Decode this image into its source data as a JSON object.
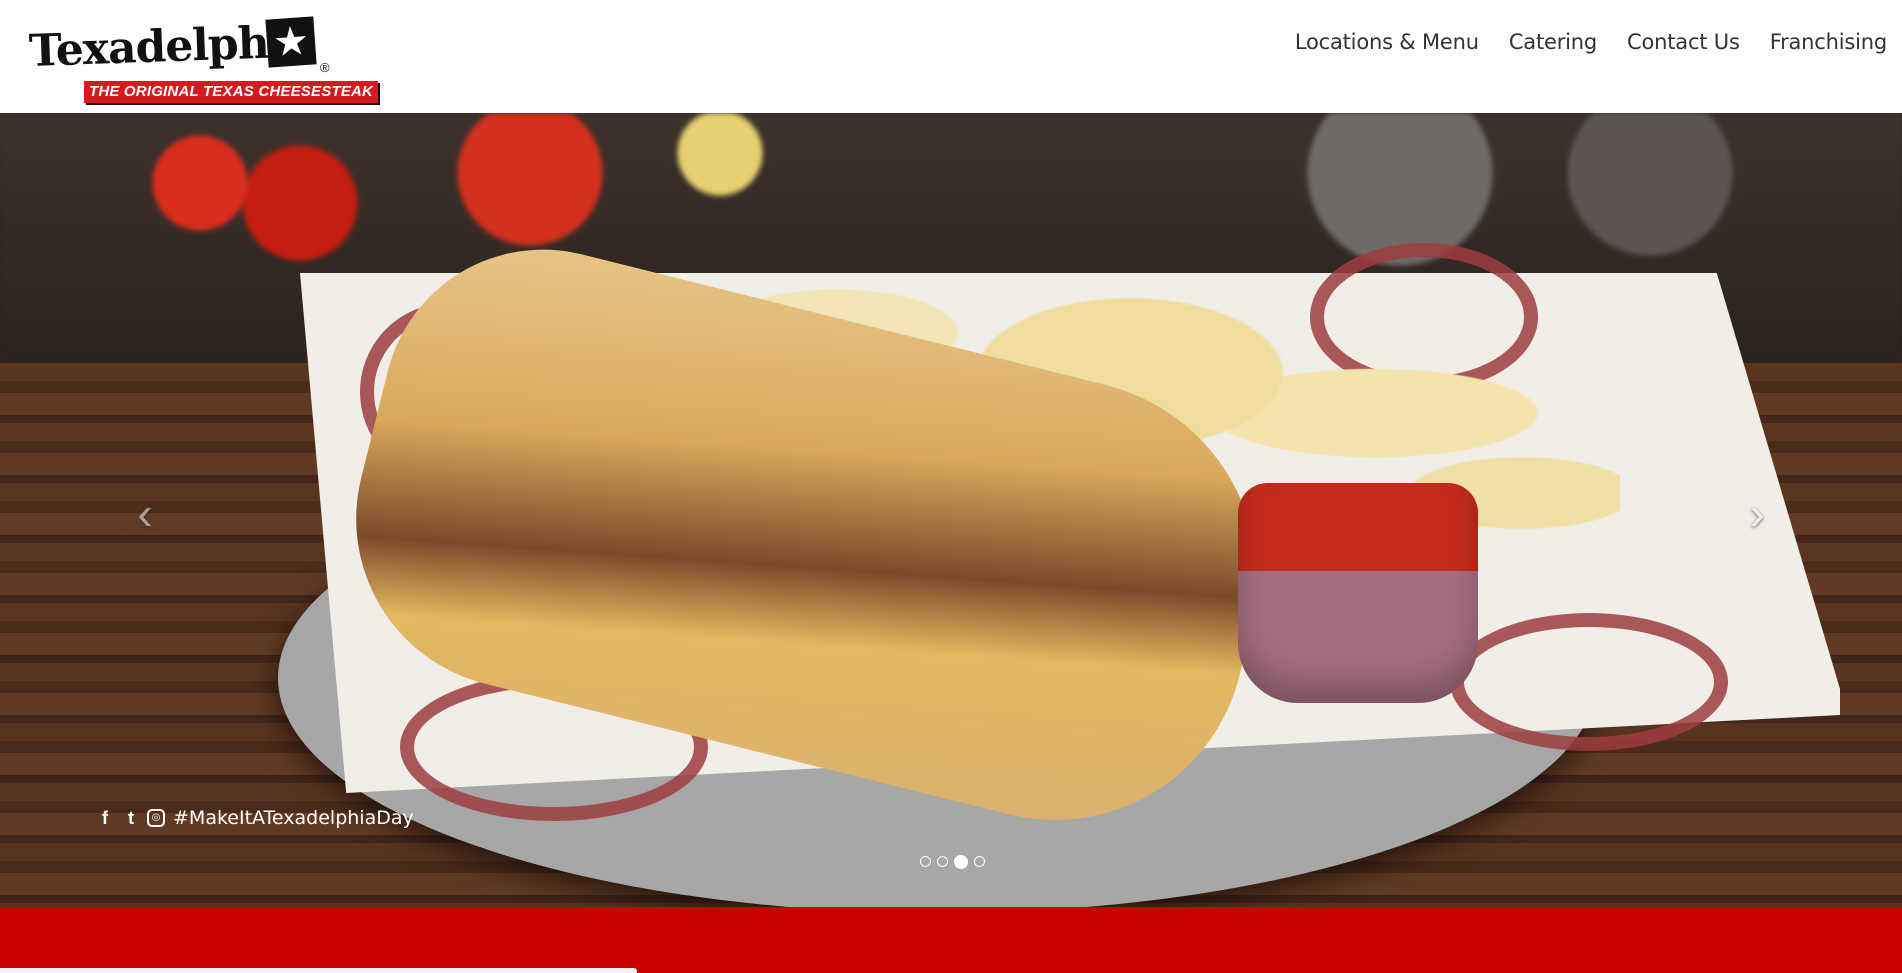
{
  "header": {
    "logo": {
      "wordmark": "Texadelphia",
      "star": "★",
      "registered": "®",
      "tagline": "THE ORIGINAL TEXAS CHEESESTEAK"
    },
    "nav": [
      {
        "label": "Locations & Menu"
      },
      {
        "label": "Catering"
      },
      {
        "label": "Contact Us"
      },
      {
        "label": "Franchising"
      }
    ]
  },
  "hero": {
    "image": "cheesesteak-with-chips-and-salsa",
    "prev_arrow": "‹",
    "next_arrow": "›",
    "social": {
      "facebook": "f",
      "twitter": "t",
      "instagram": "◎",
      "hashtag": "#MakeItATexadelphiaDay"
    },
    "slides_total": 4,
    "active_slide": 3
  },
  "colors": {
    "brand_red": "#cc0000",
    "logo_red": "#d71920",
    "nav_text": "#333333"
  }
}
